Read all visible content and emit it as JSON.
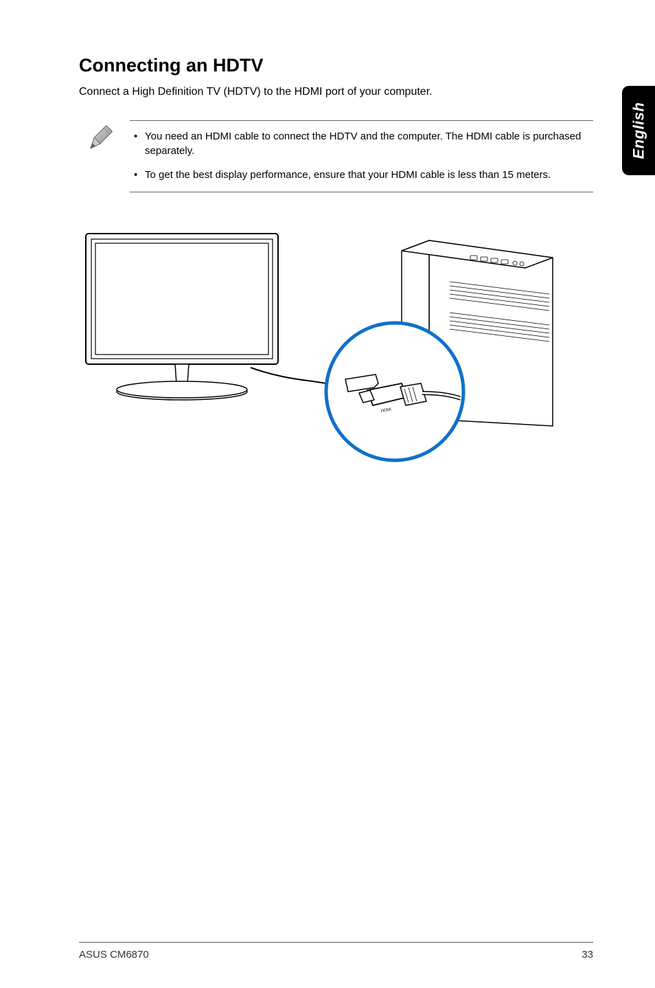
{
  "sideTab": "English",
  "heading": "Connecting an HDTV",
  "intro": "Connect a High Definition TV (HDTV) to the HDMI port of your computer.",
  "notes": [
    "You need an HDMI cable to connect the HDTV and the computer. The HDMI cable is purchased separately.",
    "To get the best display performance, ensure that your HDMI cable is less than 15 meters."
  ],
  "footer": {
    "left": "ASUS CM6870",
    "right": "33"
  }
}
